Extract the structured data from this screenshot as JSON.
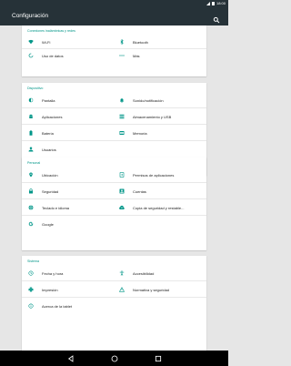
{
  "status_bar": {
    "time": "18:00"
  },
  "app_bar": {
    "title": "Configuración"
  },
  "sections": [
    {
      "title": "Conexiones inalámbricas y redes",
      "items": [
        {
          "label": "Wi-Fi",
          "icon": "wifi-icon"
        },
        {
          "label": "Bluetooth",
          "icon": "bluetooth-icon"
        },
        {
          "label": "Uso de datos",
          "icon": "data-usage-icon"
        },
        {
          "label": "Más",
          "icon": "more-icon"
        }
      ]
    },
    {
      "title": "Dispositivo",
      "items": [
        {
          "label": "Pantalla",
          "icon": "brightness-icon"
        },
        {
          "label": "Sonido/notificación",
          "icon": "bell-icon"
        },
        {
          "label": "Aplicaciones",
          "icon": "android-icon"
        },
        {
          "label": "Almacenamiento y USB",
          "icon": "storage-icon"
        },
        {
          "label": "Batería",
          "icon": "battery-icon"
        },
        {
          "label": "Memoria",
          "icon": "memory-icon"
        },
        {
          "label": "Usuarios",
          "icon": "person-icon"
        }
      ]
    },
    {
      "title": "Personal",
      "items": [
        {
          "label": "Ubicación",
          "icon": "location-icon"
        },
        {
          "label": "Permisos de aplicaciones",
          "icon": "permissions-icon"
        },
        {
          "label": "Seguridad",
          "icon": "lock-icon"
        },
        {
          "label": "Cuentas",
          "icon": "account-icon"
        },
        {
          "label": "Teclado e idioma",
          "icon": "globe-icon"
        },
        {
          "label": "Copia de seguridad y restable...",
          "icon": "cloud-upload-icon"
        },
        {
          "label": "Google",
          "icon": "google-icon"
        }
      ]
    },
    {
      "title": "Sistema",
      "items": [
        {
          "label": "Fecha y hora",
          "icon": "clock-icon"
        },
        {
          "label": "Accesibilidad",
          "icon": "accessibility-icon"
        },
        {
          "label": "Impresión",
          "icon": "print-icon"
        },
        {
          "label": "Normativa y seguridad",
          "icon": "warning-icon"
        },
        {
          "label": "Acerca de la tablet",
          "icon": "info-icon"
        }
      ]
    }
  ],
  "colors": {
    "accent": "#009688",
    "app_bar": "#263238",
    "background": "#e6e6e6"
  }
}
